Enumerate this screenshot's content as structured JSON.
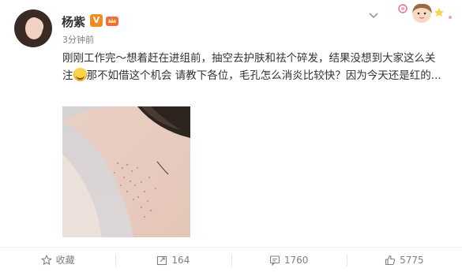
{
  "post": {
    "username": "杨紫",
    "verified_badge": "V",
    "timestamp": "3分钟前",
    "text_part1": "刚刚工作完～想着赶在进组前，抽空去护肤和祛个碎发，结果没想到大家这么关注",
    "text_part2": "那不如借这个机会 请教下各位，毛孔怎么消炎比较快？因为今天还是红的...",
    "inline_emoji": "smiling-emoji-icon"
  },
  "actions": {
    "favorite_label": "收藏",
    "repost_count": "164",
    "comment_count": "1760",
    "like_count": "5775"
  },
  "colors": {
    "username": "#333333",
    "meta": "#808080",
    "badge": "#f28a1e",
    "divider": "#eeeeee"
  },
  "icons": [
    "chevron-down-icon",
    "star-icon",
    "repost-icon",
    "comment-icon",
    "like-icon",
    "vip-crown-icon"
  ]
}
